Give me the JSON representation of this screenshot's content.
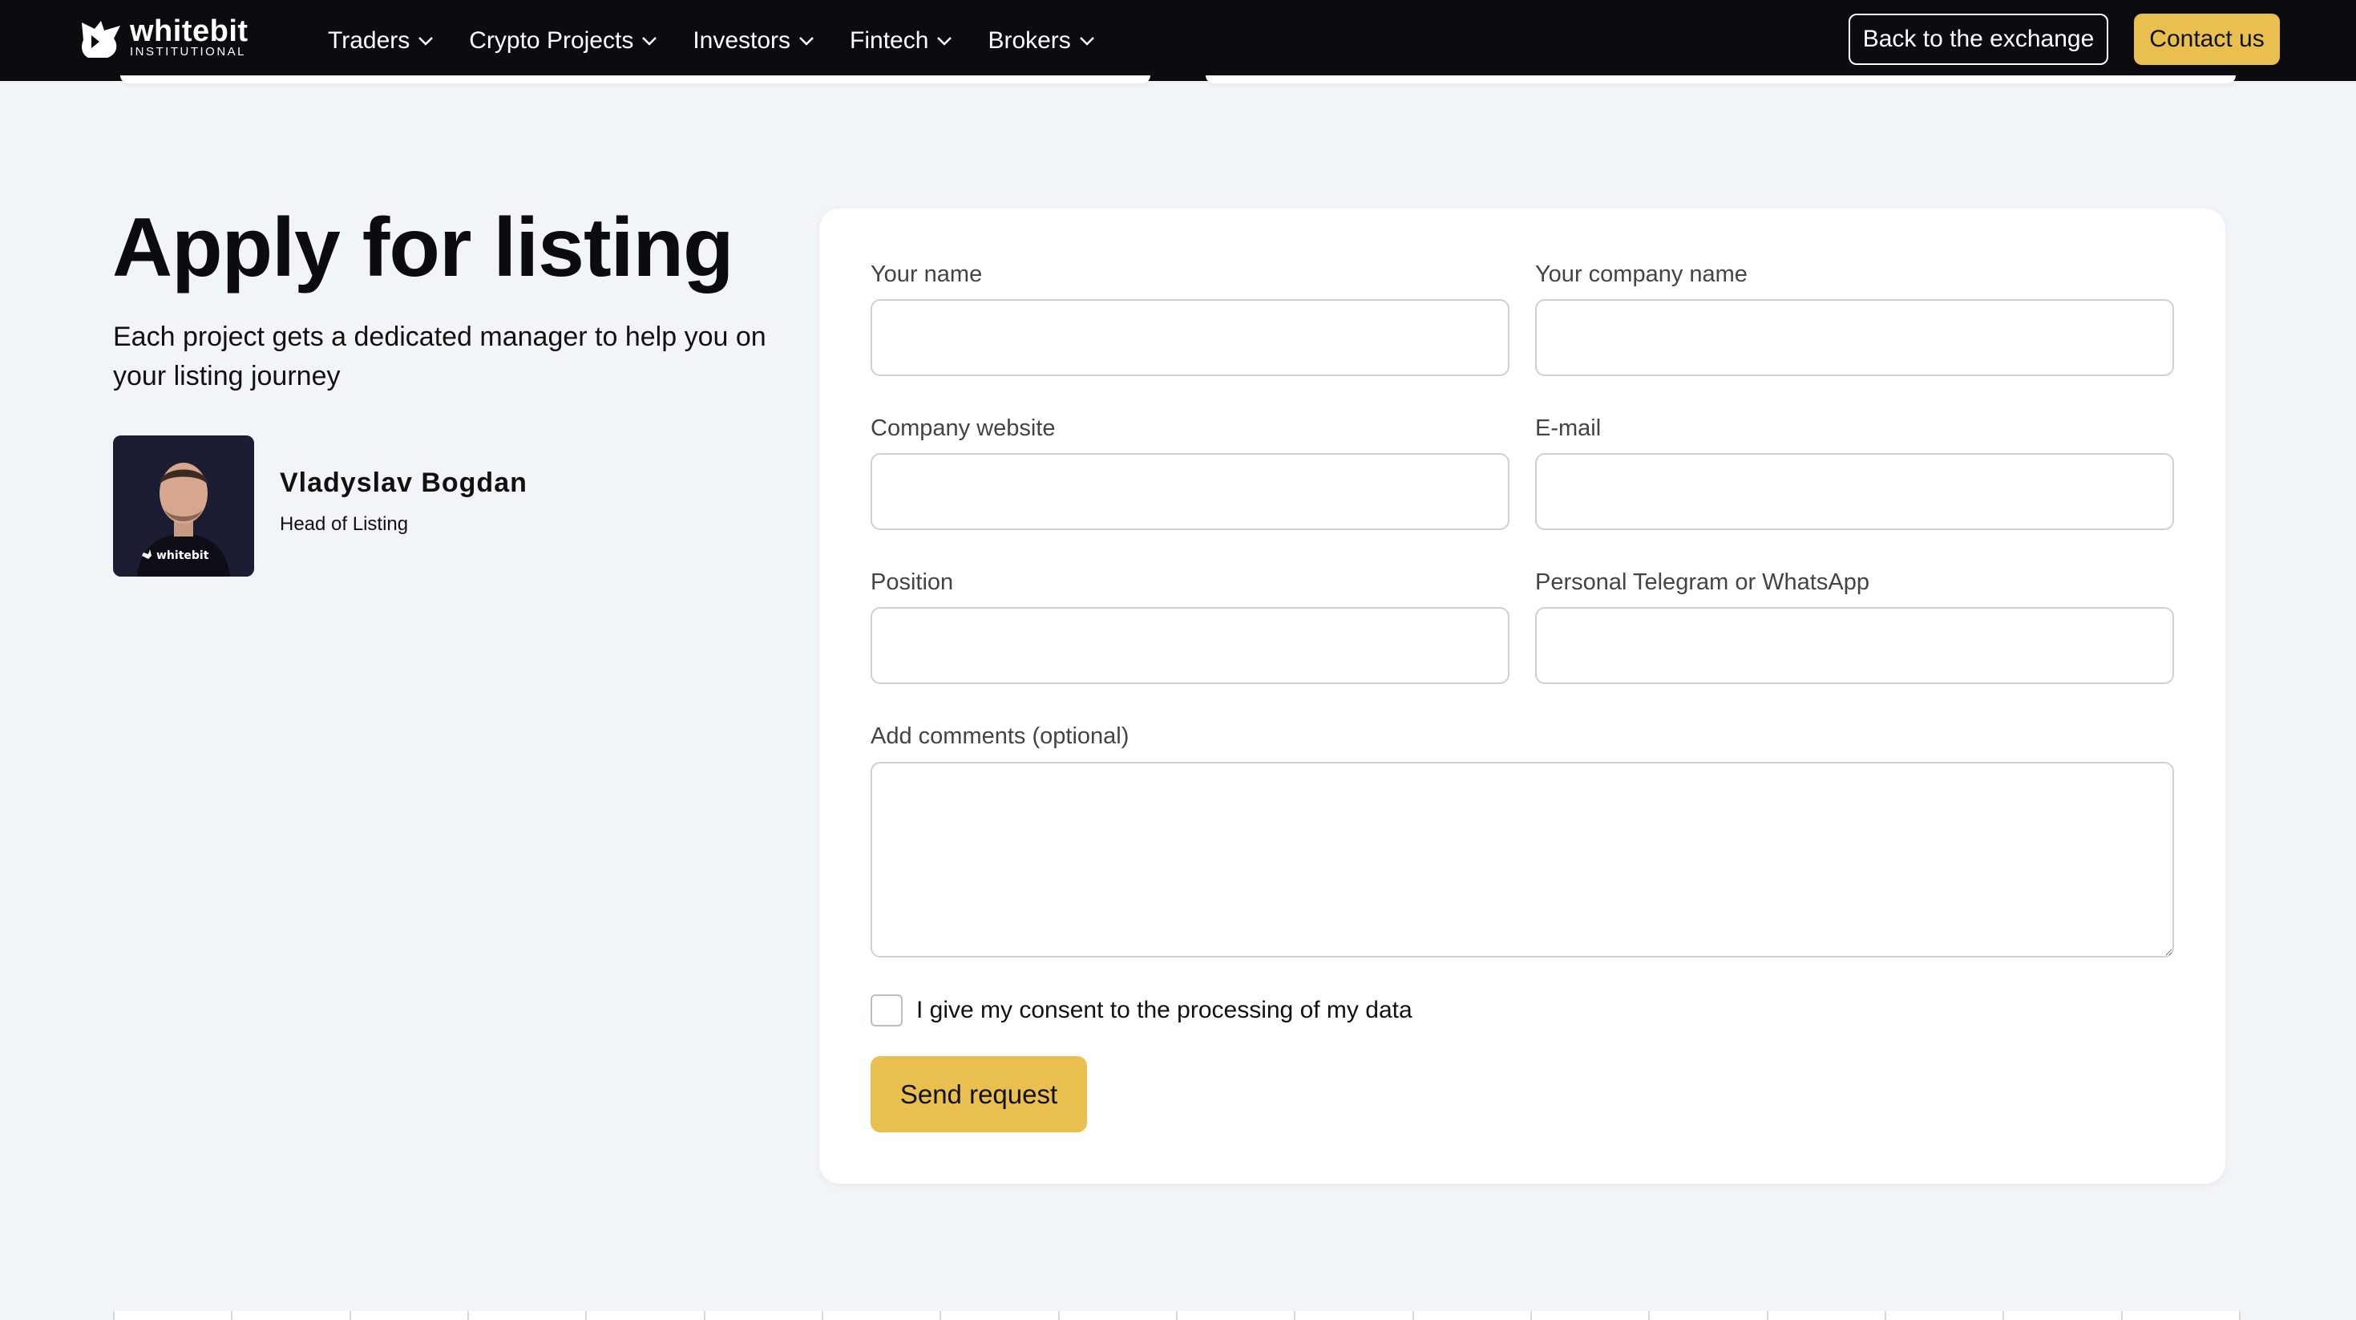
{
  "brand": {
    "name": "whitebit",
    "subtitle": "INSTITUTIONAL",
    "accent_color": "#e9bf4f",
    "nav_bg": "#0b0b10"
  },
  "nav": {
    "items": [
      {
        "label": "Traders",
        "icon": "chevron-down-icon"
      },
      {
        "label": "Crypto Projects",
        "icon": "chevron-down-icon"
      },
      {
        "label": "Investors",
        "icon": "chevron-down-icon"
      },
      {
        "label": "Fintech",
        "icon": "chevron-down-icon"
      },
      {
        "label": "Brokers",
        "icon": "chevron-down-icon"
      }
    ],
    "back_label": "Back to the exchange",
    "contact_label": "Contact us"
  },
  "hero": {
    "title": "Apply for listing",
    "subtitle": "Each project gets a dedicated manager to help you on your listing journey"
  },
  "manager": {
    "name": "Vladyslav Bogdan",
    "role": "Head of Listing"
  },
  "form": {
    "fields": [
      {
        "label": "Your name",
        "value": "",
        "placeholder": ""
      },
      {
        "label": "Your company name",
        "value": "",
        "placeholder": ""
      },
      {
        "label": "Company website",
        "value": "",
        "placeholder": ""
      },
      {
        "label": "E-mail",
        "value": "",
        "placeholder": ""
      },
      {
        "label": "Position",
        "value": "",
        "placeholder": ""
      },
      {
        "label": "Personal Telegram or WhatsApp",
        "value": "",
        "placeholder": ""
      }
    ],
    "comments_label": "Add comments (optional)",
    "comments_value": "",
    "consent_label": "I give my consent to the processing of my data",
    "consent_checked": false,
    "submit_label": "Send request"
  }
}
